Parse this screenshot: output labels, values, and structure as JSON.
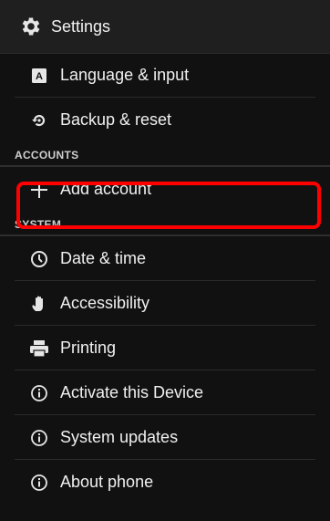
{
  "actionbar": {
    "title": "Settings",
    "icon": "gear-icon"
  },
  "list": {
    "items_top": [
      {
        "label": "Language & input",
        "icon": "keyboard-a-icon"
      },
      {
        "label": "Backup & reset",
        "icon": "backup-reset-icon"
      }
    ],
    "accounts_header": "ACCOUNTS",
    "add_account": {
      "label": "Add account",
      "icon": "plus-icon"
    },
    "system_header": "SYSTEM",
    "items_system": [
      {
        "label": "Date & time",
        "icon": "clock-icon"
      },
      {
        "label": "Accessibility",
        "icon": "hand-icon"
      },
      {
        "label": "Printing",
        "icon": "printer-icon"
      },
      {
        "label": "Activate this Device",
        "icon": "info-icon"
      },
      {
        "label": "System updates",
        "icon": "info-icon"
      },
      {
        "label": "About phone",
        "icon": "info-icon"
      }
    ]
  },
  "colors": {
    "highlight": "#ff0000",
    "background": "#111111"
  }
}
